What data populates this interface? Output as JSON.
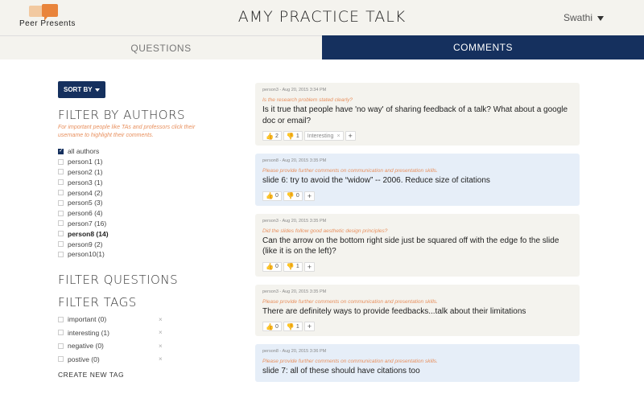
{
  "header": {
    "logo_text": "Peer Presents",
    "title": "AMY PRACTICE TALK",
    "user": "Swathi"
  },
  "tabs": [
    {
      "label": "QUESTIONS",
      "active": false
    },
    {
      "label": "COMMENTS",
      "active": true
    }
  ],
  "colors": {
    "navy": "#15305e",
    "orange": "#e8905e",
    "gray_card": "#f4f3ee",
    "blue_card": "#e6eef8"
  },
  "sidebar": {
    "sort_label": "SORT BY",
    "filter_authors_title": "FILTER BY AUTHORS",
    "filter_authors_hint": "For important people like TAs and professors click their username to highlight their comments.",
    "authors": [
      {
        "label": "all authors",
        "checked": true,
        "bold": false
      },
      {
        "label": "person1 (1)",
        "checked": false,
        "bold": false
      },
      {
        "label": "person2 (1)",
        "checked": false,
        "bold": false
      },
      {
        "label": "person3 (1)",
        "checked": false,
        "bold": false
      },
      {
        "label": "person4 (2)",
        "checked": false,
        "bold": false
      },
      {
        "label": "person5 (3)",
        "checked": false,
        "bold": false
      },
      {
        "label": "person6 (4)",
        "checked": false,
        "bold": false
      },
      {
        "label": "person7 (16)",
        "checked": false,
        "bold": false
      },
      {
        "label": "person8 (14)",
        "checked": false,
        "bold": true
      },
      {
        "label": "person9 (2)",
        "checked": false,
        "bold": false
      },
      {
        "label": "person10(1)",
        "checked": false,
        "bold": false
      }
    ],
    "filter_questions_title": "FILTER QUESTIONS",
    "filter_tags_title": "FILTER TAGS",
    "tags": [
      {
        "label": "important (0)",
        "x": "×"
      },
      {
        "label": "interesting (1)",
        "x": "×"
      },
      {
        "label": "negative (0)",
        "x": "×"
      },
      {
        "label": "postive (0)",
        "x": "×"
      }
    ],
    "create_tag_label": "CREATE NEW TAG"
  },
  "comments": [
    {
      "meta": "person3 - Aug 20, 2015 3:34 PM",
      "question": "Is the research problem stated clearly?",
      "body": "Is it true that people have 'no way' of sharing feedback of a talk? What about a google doc or email?",
      "up": "2",
      "down": "1",
      "tag": "Interesting",
      "tag_x": "×",
      "plus": "+",
      "style": "gray"
    },
    {
      "meta": "person8 - Aug 20, 2015 3:35 PM",
      "question": "Please provide further comments on communication and presentation skills.",
      "body": "slide 6: try to avoid the “widow” -- 2006. Reduce size of citations",
      "up": "0",
      "down": "0",
      "tag": "",
      "tag_x": "",
      "plus": "+",
      "style": "blue"
    },
    {
      "meta": "person3 - Aug 20, 2015 3:35 PM",
      "question": "Did the slides follow good aesthetic design principles?",
      "body": "Can the arrow on the bottom right side just be squared off with the edge fo the slide (like it is on the left)?",
      "up": "0",
      "down": "1",
      "tag": "",
      "tag_x": "",
      "plus": "+",
      "style": "gray"
    },
    {
      "meta": "person3 - Aug 20, 2015 3:35 PM",
      "question": "Please provide further comments on communication and presentation skills.",
      "body": "There are definitely ways to provide feedbacks...talk about their limitations",
      "up": "0",
      "down": "1",
      "tag": "",
      "tag_x": "",
      "plus": "+",
      "style": "gray"
    },
    {
      "meta": "person8 - Aug 20, 2015 3:36 PM",
      "question": "Please provide further comments on communication and presentation skills.",
      "body": "slide 7: all of these should have citations too",
      "up": "",
      "down": "",
      "tag": "",
      "tag_x": "",
      "plus": "",
      "style": "blue"
    }
  ]
}
